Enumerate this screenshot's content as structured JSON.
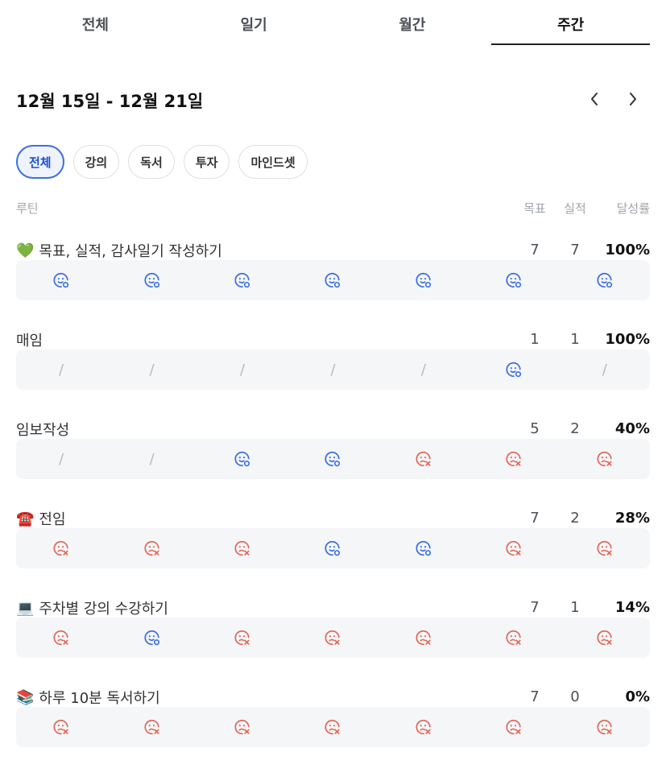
{
  "tabs": [
    {
      "label": "전체"
    },
    {
      "label": "일기"
    },
    {
      "label": "월간"
    },
    {
      "label": "주간"
    }
  ],
  "active_tab": "주간",
  "date_range": "12월 15일 - 12월 21일",
  "filters": [
    "전체",
    "강의",
    "독서",
    "투자",
    "마인드셋"
  ],
  "active_filter": "전체",
  "table_header": {
    "routine": "루틴",
    "goal": "목표",
    "actual": "실적",
    "rate": "달성률"
  },
  "colors": {
    "success": "#3b6fe0",
    "fail": "#e06a5b",
    "active": "#1e4fc9"
  },
  "routines": [
    {
      "emoji": "💚",
      "name": "목표, 실적, 감사일기 작성하기",
      "goal": "7",
      "actual": "7",
      "rate": "100%",
      "days": [
        "success",
        "success",
        "success",
        "success",
        "success",
        "success",
        "success"
      ]
    },
    {
      "emoji": "",
      "name": "매임",
      "goal": "1",
      "actual": "1",
      "rate": "100%",
      "days": [
        "none",
        "none",
        "none",
        "none",
        "none",
        "success",
        "none"
      ]
    },
    {
      "emoji": "",
      "name": "임보작성",
      "goal": "5",
      "actual": "2",
      "rate": "40%",
      "days": [
        "none",
        "none",
        "success",
        "success",
        "fail",
        "fail",
        "fail"
      ]
    },
    {
      "emoji": "☎️",
      "name": "전임",
      "goal": "7",
      "actual": "2",
      "rate": "28%",
      "days": [
        "fail",
        "fail",
        "fail",
        "success",
        "success",
        "fail",
        "fail"
      ]
    },
    {
      "emoji": "💻",
      "name": "주차별 강의 수강하기",
      "goal": "7",
      "actual": "1",
      "rate": "14%",
      "days": [
        "fail",
        "success",
        "fail",
        "fail",
        "fail",
        "fail",
        "fail"
      ]
    },
    {
      "emoji": "📚",
      "name": "하루 10분 독서하기",
      "goal": "7",
      "actual": "0",
      "rate": "0%",
      "days": [
        "fail",
        "fail",
        "fail",
        "fail",
        "fail",
        "fail",
        "fail"
      ]
    }
  ]
}
